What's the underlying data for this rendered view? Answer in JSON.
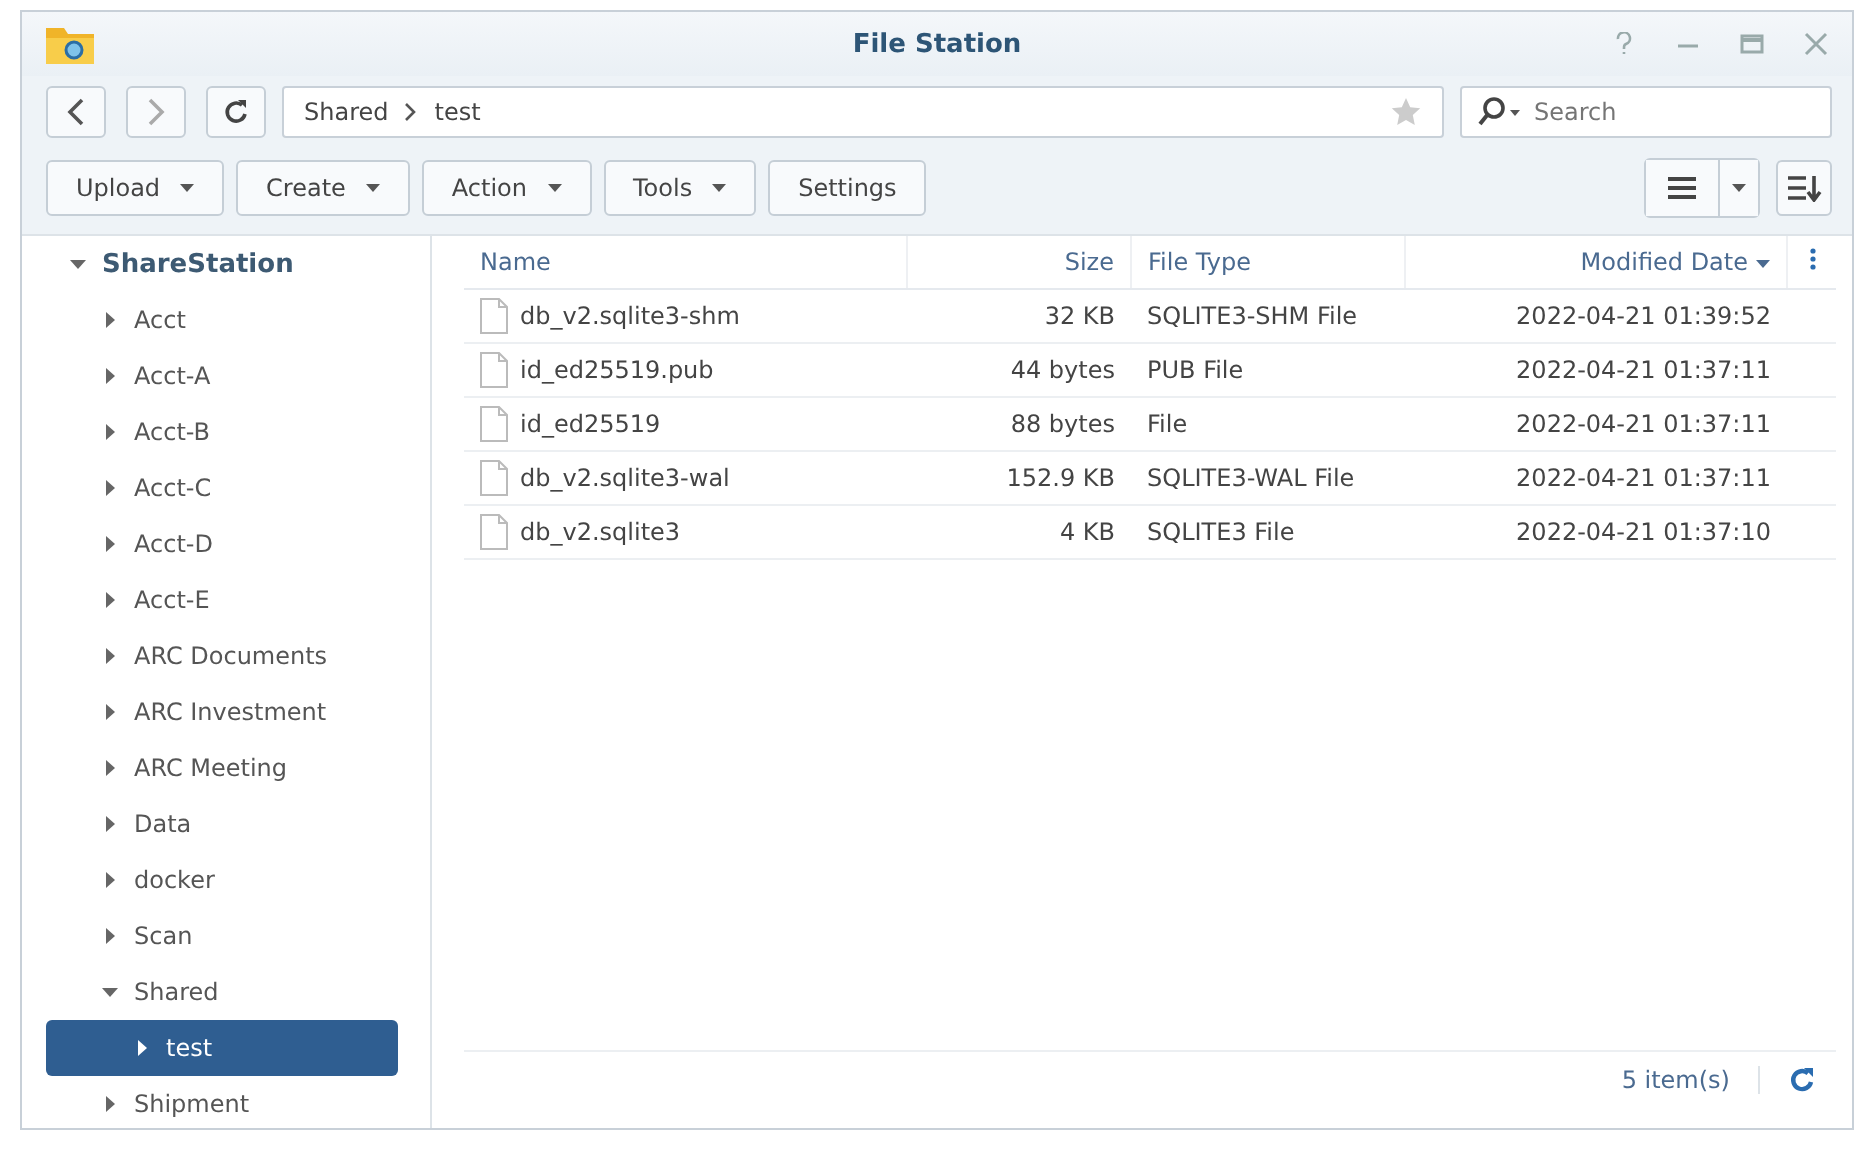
{
  "window": {
    "title": "File Station"
  },
  "path": {
    "segments": [
      "Shared",
      "test"
    ],
    "starred": false
  },
  "search": {
    "placeholder": "Search"
  },
  "toolbar": [
    {
      "label": "Upload",
      "dropdown": true
    },
    {
      "label": "Create",
      "dropdown": true
    },
    {
      "label": "Action",
      "dropdown": true
    },
    {
      "label": "Tools",
      "dropdown": true
    },
    {
      "label": "Settings",
      "dropdown": false
    }
  ],
  "sidebar": {
    "items": [
      {
        "label": "ShareStation",
        "expanded": true,
        "selected": false,
        "children": [
          {
            "label": "Acct",
            "expanded": false,
            "selected": false
          },
          {
            "label": "Acct-A",
            "expanded": false,
            "selected": false
          },
          {
            "label": "Acct-B",
            "expanded": false,
            "selected": false
          },
          {
            "label": "Acct-C",
            "expanded": false,
            "selected": false
          },
          {
            "label": "Acct-D",
            "expanded": false,
            "selected": false
          },
          {
            "label": "Acct-E",
            "expanded": false,
            "selected": false
          },
          {
            "label": "ARC Documents",
            "expanded": false,
            "selected": false
          },
          {
            "label": "ARC Investment",
            "expanded": false,
            "selected": false
          },
          {
            "label": "ARC Meeting",
            "expanded": false,
            "selected": false
          },
          {
            "label": "Data",
            "expanded": false,
            "selected": false
          },
          {
            "label": "docker",
            "expanded": false,
            "selected": false
          },
          {
            "label": "Scan",
            "expanded": false,
            "selected": false
          },
          {
            "label": "Shared",
            "expanded": true,
            "selected": false,
            "children": [
              {
                "label": "test",
                "expanded": false,
                "selected": true
              }
            ]
          },
          {
            "label": "Shipment",
            "expanded": false,
            "selected": false
          }
        ]
      }
    ]
  },
  "table": {
    "columns": [
      {
        "label": "Name",
        "sorted": false
      },
      {
        "label": "Size",
        "sorted": false
      },
      {
        "label": "File Type",
        "sorted": false
      },
      {
        "label": "Modified Date",
        "sorted": true
      }
    ],
    "rows": [
      {
        "name": "db_v2.sqlite3-shm",
        "size": "32 KB",
        "type": "SQLITE3-SHM File",
        "modified": "2022-04-21 01:39:52"
      },
      {
        "name": "id_ed25519.pub",
        "size": "44 bytes",
        "type": "PUB File",
        "modified": "2022-04-21 01:37:11"
      },
      {
        "name": "id_ed25519",
        "size": "88 bytes",
        "type": "File",
        "modified": "2022-04-21 01:37:11"
      },
      {
        "name": "db_v2.sqlite3-wal",
        "size": "152.9 KB",
        "type": "SQLITE3-WAL File",
        "modified": "2022-04-21 01:37:11"
      },
      {
        "name": "db_v2.sqlite3",
        "size": "4 KB",
        "type": "SQLITE3 File",
        "modified": "2022-04-21 01:37:10"
      }
    ]
  },
  "status_bar": {
    "count": "5 item(s)"
  }
}
